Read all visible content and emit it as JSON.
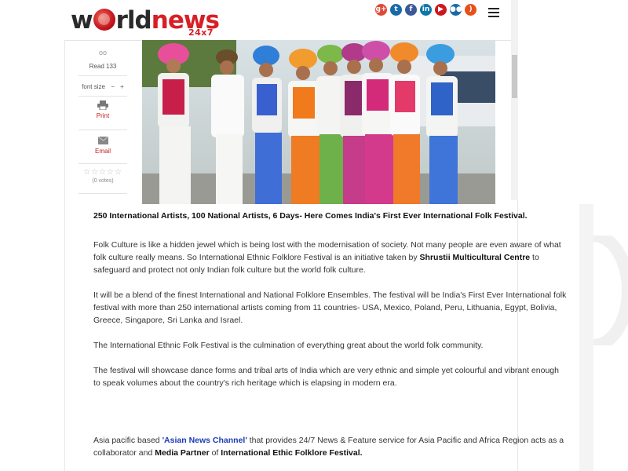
{
  "header": {
    "logo_w": "w",
    "logo_rld": "rld",
    "logo_news": "news",
    "logo_sub": "24x7",
    "social": [
      {
        "name": "google-plus-icon",
        "glyph": "g+",
        "color": "#dd4b39"
      },
      {
        "name": "twitter-icon",
        "glyph": "t",
        "color": "#1a6aa8"
      },
      {
        "name": "facebook-icon",
        "glyph": "f",
        "color": "#3b5998"
      },
      {
        "name": "linkedin-icon",
        "glyph": "in",
        "color": "#0e76a8"
      },
      {
        "name": "youtube-icon",
        "glyph": "▶",
        "color": "#cc181e"
      },
      {
        "name": "flickr-icon",
        "glyph": "●●",
        "color": "#1a6aa8"
      },
      {
        "name": "rss-icon",
        "glyph": ")",
        "color": "#e8501a"
      }
    ]
  },
  "tools": {
    "read": "Read 133",
    "font_size": "font size",
    "font_minus": "−",
    "font_plus": "+",
    "print": "Print",
    "email": "Email",
    "stars": "☆☆☆☆☆",
    "votes": "(0 votes)"
  },
  "article": {
    "headline": "250 International Artists, 100 National Artists, 6 Days- Here Comes India's First Ever International Folk Festival.",
    "p1_a": " Folk Culture is like a hidden jewel which is being lost with the modernisation of society. Not many people are even aware of what folk culture really means. So International Ethnic Folklore Festival is an initiative taken by ",
    "p1_b": "Shrustii Multicultural Centre",
    "p1_c": " to safeguard and protect not only Indian folk culture but the world folk culture.",
    "p2": "It will be a blend of the finest International and National Folklore Ensembles. The festival will be India's First Ever International folk festival with more than 250 international artists coming from 11 countries- USA, Mexico, Poland, Peru, Lithuania, Egypt, Bolivia, Greece, Singapore, Sri Lanka and Israel.",
    "p3": "The International Ethnic Folk Festival is the culmination of everything great about the world folk community.",
    "p4": "The festival will showcase dance forms and tribal arts of India which are very ethnic and simple yet colourful and vibrant enough to speak volumes about the country's rich heritage which is elapsing in modern era.",
    "p5_a": "Asia pacific based ",
    "p5_b": "'Asian News Channel'",
    "p5_c": " that provides 24/7 News & Feature service for Asia Pacific and Africa Region acts as a collaborator and ",
    "p5_d": "Media Partner",
    "p5_e": " of ",
    "p5_f": "International Ethic Folklore Festival."
  },
  "colors": {
    "accent_red": "#d71f26",
    "link_blue": "#1b3bb5"
  }
}
